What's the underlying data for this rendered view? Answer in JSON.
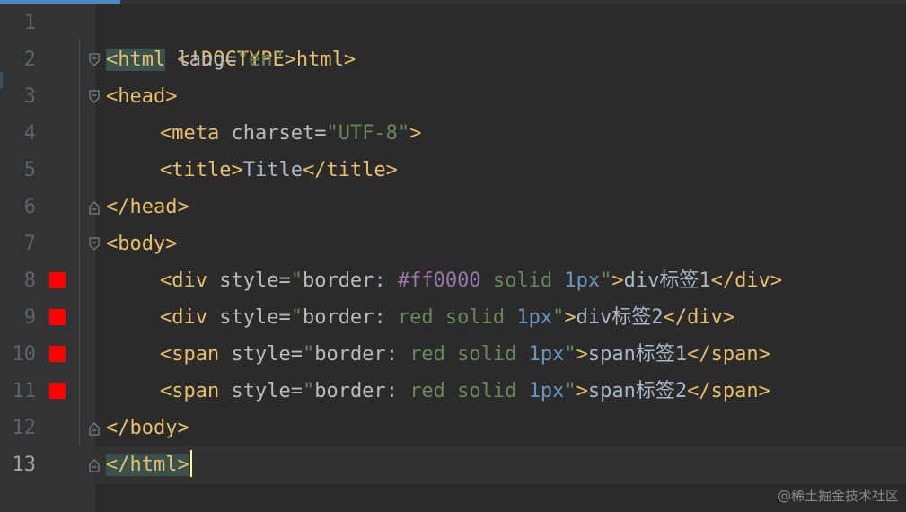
{
  "colors": {
    "background": "#2b2b2b",
    "gutter": "#313335",
    "tag": "#e8bf6a",
    "attr_name": "#bababa",
    "attr_value": "#6a8759",
    "text": "#a9b7c6",
    "number": "#6897bb",
    "color_hex": "#9876aa",
    "swatch": "#ff0000",
    "tag_highlight": "#3b514d"
  },
  "watermark": "@稀土掘金技术社区",
  "lines": [
    {
      "no": "1",
      "tokens": [
        {
          "t": "<!DOCTYPE html>",
          "c": "tag"
        }
      ]
    },
    {
      "no": "2",
      "tokens": [
        {
          "t": "<html",
          "c": "tag",
          "hl": true
        },
        {
          "t": " lang=",
          "c": "attr"
        },
        {
          "t": "\"en\"",
          "c": "val"
        },
        {
          "t": ">",
          "c": "tag"
        }
      ]
    },
    {
      "no": "3",
      "tokens": [
        {
          "t": "<head>",
          "c": "tag"
        }
      ]
    },
    {
      "no": "4",
      "tokens": [
        {
          "t": "<meta",
          "c": "tag"
        },
        {
          "t": " charset=",
          "c": "attr"
        },
        {
          "t": "\"UTF-8\"",
          "c": "val"
        },
        {
          "t": ">",
          "c": "tag"
        }
      ]
    },
    {
      "no": "5",
      "tokens": [
        {
          "t": "<title>",
          "c": "tag"
        },
        {
          "t": "Title",
          "c": "text"
        },
        {
          "t": "</title>",
          "c": "tag"
        }
      ]
    },
    {
      "no": "6",
      "tokens": [
        {
          "t": "</head>",
          "c": "tag"
        }
      ]
    },
    {
      "no": "7",
      "tokens": [
        {
          "t": "<body>",
          "c": "tag"
        }
      ]
    },
    {
      "no": "8",
      "tokens": [
        {
          "t": "<div",
          "c": "tag"
        },
        {
          "t": " style=",
          "c": "attr"
        },
        {
          "t": "\"",
          "c": "val"
        },
        {
          "t": "border",
          "c": "attr"
        },
        {
          "t": ": ",
          "c": "text"
        },
        {
          "t": "#ff0000",
          "c": "hex"
        },
        {
          "t": " solid ",
          "c": "val"
        },
        {
          "t": "1px",
          "c": "num"
        },
        {
          "t": "\"",
          "c": "val"
        },
        {
          "t": ">",
          "c": "tag"
        },
        {
          "t": "div标签1",
          "c": "text"
        },
        {
          "t": "</div>",
          "c": "tag"
        }
      ]
    },
    {
      "no": "9",
      "tokens": [
        {
          "t": "<div",
          "c": "tag"
        },
        {
          "t": " style=",
          "c": "attr"
        },
        {
          "t": "\"",
          "c": "val"
        },
        {
          "t": "border",
          "c": "attr"
        },
        {
          "t": ": ",
          "c": "text"
        },
        {
          "t": "red solid ",
          "c": "val"
        },
        {
          "t": "1px",
          "c": "num"
        },
        {
          "t": "\"",
          "c": "val"
        },
        {
          "t": ">",
          "c": "tag"
        },
        {
          "t": "div标签2",
          "c": "text"
        },
        {
          "t": "</div>",
          "c": "tag"
        }
      ]
    },
    {
      "no": "10",
      "tokens": [
        {
          "t": "<span",
          "c": "tag"
        },
        {
          "t": " style=",
          "c": "attr"
        },
        {
          "t": "\"",
          "c": "val"
        },
        {
          "t": "border",
          "c": "attr"
        },
        {
          "t": ": ",
          "c": "text"
        },
        {
          "t": "red solid ",
          "c": "val"
        },
        {
          "t": "1px",
          "c": "num"
        },
        {
          "t": "\"",
          "c": "val"
        },
        {
          "t": ">",
          "c": "tag"
        },
        {
          "t": "span标签1",
          "c": "text"
        },
        {
          "t": "</span>",
          "c": "tag"
        }
      ]
    },
    {
      "no": "11",
      "tokens": [
        {
          "t": "<span",
          "c": "tag"
        },
        {
          "t": " style=",
          "c": "attr"
        },
        {
          "t": "\"",
          "c": "val"
        },
        {
          "t": "border",
          "c": "attr"
        },
        {
          "t": ": ",
          "c": "text"
        },
        {
          "t": "red solid ",
          "c": "val"
        },
        {
          "t": "1px",
          "c": "num"
        },
        {
          "t": "\"",
          "c": "val"
        },
        {
          "t": ">",
          "c": "tag"
        },
        {
          "t": "span标签2",
          "c": "text"
        },
        {
          "t": "</span>",
          "c": "tag"
        }
      ]
    },
    {
      "no": "12",
      "tokens": [
        {
          "t": "</body>",
          "c": "tag"
        }
      ]
    },
    {
      "no": "13",
      "tokens": [
        {
          "t": "</html>",
          "c": "tag",
          "hl": true
        }
      ]
    }
  ]
}
